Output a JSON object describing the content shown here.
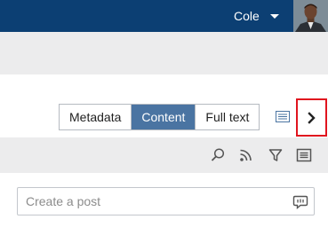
{
  "header": {
    "user_name": "Cole"
  },
  "view_tabs": [
    {
      "label": "Metadata",
      "active": false
    },
    {
      "label": "Content",
      "active": true
    },
    {
      "label": "Full text",
      "active": false
    }
  ],
  "toolbar": {
    "icons": [
      "search-icon",
      "rss-feed-icon",
      "filter-icon",
      "list-view-icon"
    ]
  },
  "composer": {
    "placeholder": "Create a post"
  },
  "colors": {
    "header_bg": "#0c3f73",
    "active_tab": "#4a74a2",
    "highlight_border": "#e0141e"
  }
}
